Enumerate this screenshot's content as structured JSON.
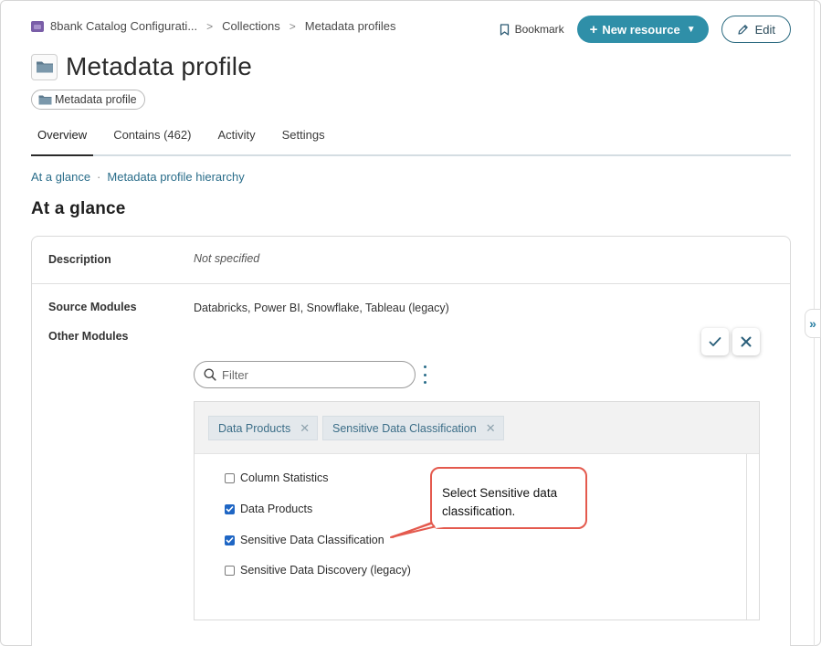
{
  "breadcrumb": {
    "items": [
      "8bank Catalog Configurati...",
      "Collections",
      "Metadata profiles"
    ],
    "separator": ">"
  },
  "actions": {
    "bookmark": "Bookmark",
    "new_resource": "New resource",
    "edit": "Edit"
  },
  "page": {
    "title": "Metadata profile",
    "type_chip": "Metadata profile"
  },
  "tabs": [
    {
      "label": "Overview",
      "active": true
    },
    {
      "label": "Contains (462)",
      "active": false
    },
    {
      "label": "Activity",
      "active": false
    },
    {
      "label": "Settings",
      "active": false
    }
  ],
  "anchors": {
    "first": "At a glance",
    "separator": "·",
    "second": "Metadata profile hierarchy"
  },
  "section": {
    "title": "At a glance"
  },
  "card": {
    "description_label": "Description",
    "description_value": "Not specified",
    "source_modules_label": "Source Modules",
    "source_modules_value": "Databricks,  Power BI,  Snowflake,  Tableau (legacy)",
    "other_modules_label": "Other Modules"
  },
  "editor": {
    "filter_placeholder": "Filter",
    "selected_tags": [
      "Data Products",
      "Sensitive Data Classification"
    ],
    "options": [
      {
        "label": "Column Statistics",
        "checked": false
      },
      {
        "label": "Data Products",
        "checked": true
      },
      {
        "label": "Sensitive Data Classification",
        "checked": true
      },
      {
        "label": "Sensitive Data Discovery (legacy)",
        "checked": false
      }
    ]
  },
  "callout": {
    "text": "Select Sensitive data classification."
  },
  "colors": {
    "accent": "#2f8fa8",
    "link": "#2a6d8a",
    "checkbox": "#1f66c4",
    "callout_border": "#e45a4e"
  },
  "icons": [
    "app-icon",
    "bookmark-icon",
    "plus-icon",
    "chevron-down-icon",
    "pencil-icon",
    "folder-icon",
    "check-icon",
    "close-icon",
    "search-icon",
    "kebab-icon",
    "double-chevron-right-icon"
  ]
}
